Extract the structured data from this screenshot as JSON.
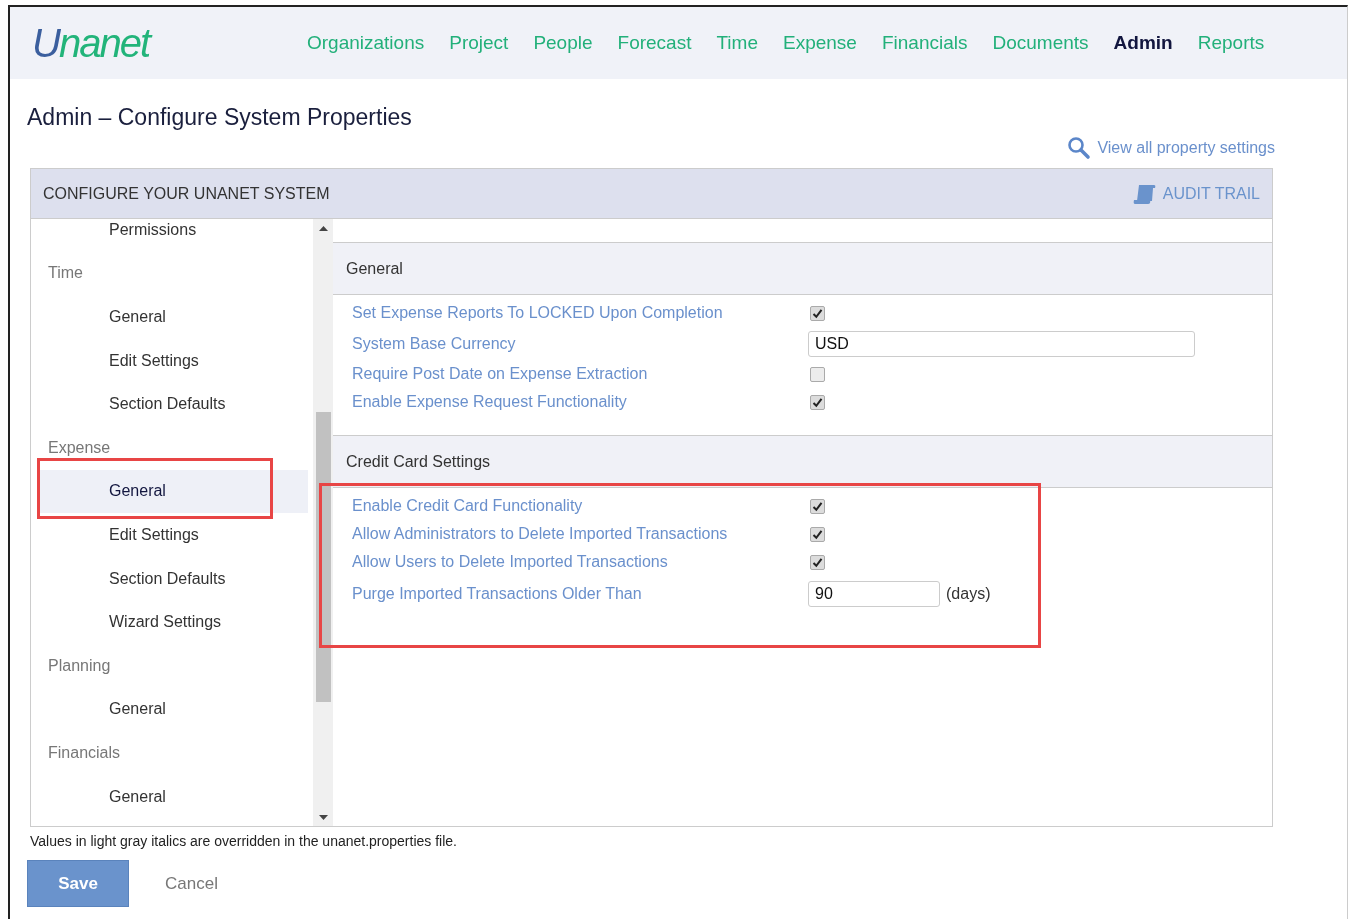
{
  "header": {
    "logo": "Unanet",
    "nav": [
      {
        "label": "Organizations",
        "selected": false
      },
      {
        "label": "Project",
        "selected": false
      },
      {
        "label": "People",
        "selected": false
      },
      {
        "label": "Forecast",
        "selected": false
      },
      {
        "label": "Time",
        "selected": false
      },
      {
        "label": "Expense",
        "selected": false
      },
      {
        "label": "Financials",
        "selected": false
      },
      {
        "label": "Documents",
        "selected": false
      },
      {
        "label": "Admin",
        "selected": true
      },
      {
        "label": "Reports",
        "selected": false
      }
    ]
  },
  "page_title": "Admin – Configure System Properties",
  "view_all_link": "View all property settings",
  "panel": {
    "title": "CONFIGURE YOUR UNANET SYSTEM",
    "audit_trail": "AUDIT TRAIL",
    "sidebar": [
      {
        "children": [
          {
            "label": "Permissions",
            "selected": false,
            "highlighted": false
          }
        ]
      },
      {
        "label": "Time",
        "children": [
          {
            "label": "General",
            "selected": false,
            "highlighted": false
          },
          {
            "label": "Edit Settings",
            "selected": false,
            "highlighted": false
          },
          {
            "label": "Section Defaults",
            "selected": false,
            "highlighted": false
          }
        ]
      },
      {
        "label": "Expense",
        "children": [
          {
            "label": "General",
            "selected": true,
            "highlighted": true
          },
          {
            "label": "Edit Settings",
            "selected": false,
            "highlighted": false
          },
          {
            "label": "Section Defaults",
            "selected": false,
            "highlighted": false
          },
          {
            "label": "Wizard Settings",
            "selected": false,
            "highlighted": false
          }
        ]
      },
      {
        "label": "Planning",
        "children": [
          {
            "label": "General",
            "selected": false,
            "highlighted": false
          }
        ]
      },
      {
        "label": "Financials",
        "children": [
          {
            "label": "General",
            "selected": false,
            "highlighted": false
          }
        ]
      }
    ],
    "sections": [
      {
        "title": "General",
        "highlighted": false,
        "rows": [
          {
            "kind": "checkbox",
            "label": "Set Expense Reports To LOCKED Upon Completion",
            "checked": true
          },
          {
            "kind": "text",
            "label": "System Base Currency",
            "value": "USD"
          },
          {
            "kind": "checkbox",
            "label": "Require Post Date on Expense Extraction",
            "checked": false
          },
          {
            "kind": "checkbox",
            "label": "Enable Expense Request Functionality",
            "checked": true
          }
        ]
      },
      {
        "title": "Credit Card Settings",
        "highlighted": true,
        "rows": [
          {
            "kind": "checkbox",
            "label": "Enable Credit Card Functionality",
            "checked": true
          },
          {
            "kind": "checkbox",
            "label": "Allow Administrators to Delete Imported Transactions",
            "checked": true
          },
          {
            "kind": "checkbox",
            "label": "Allow Users to Delete Imported Transactions",
            "checked": true
          },
          {
            "kind": "number",
            "label": "Purge Imported Transactions Older Than",
            "value": "90",
            "unit": "(days)"
          }
        ]
      }
    ]
  },
  "footnote": "Values in light gray italics are overridden in the unanet.properties file.",
  "buttons": {
    "save": "Save",
    "cancel": "Cancel"
  }
}
